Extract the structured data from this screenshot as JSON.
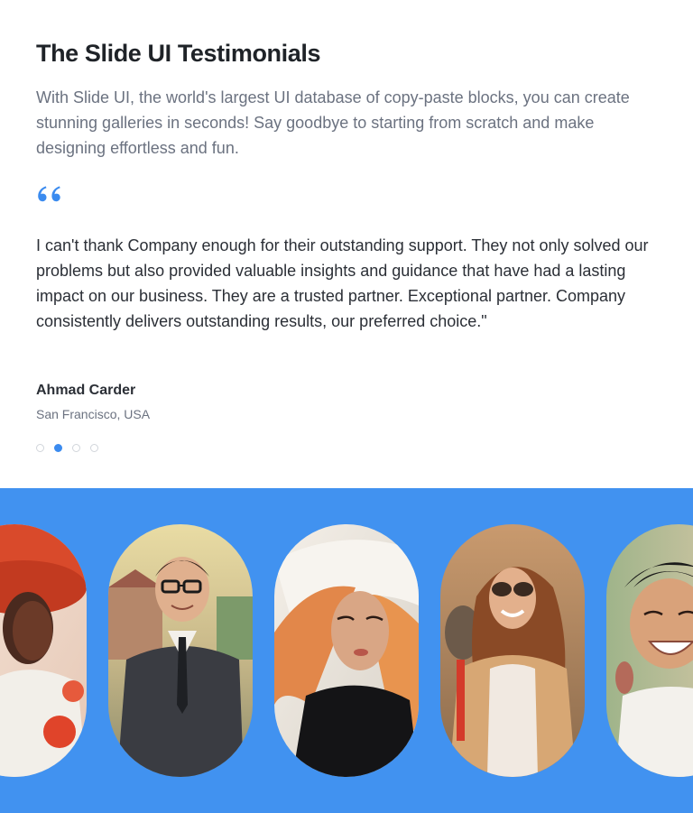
{
  "title": "The Slide UI Testimonials",
  "subtitle": "With Slide UI, the world's largest UI database of copy-paste blocks, you can create stunning galleries in seconds! Say goodbye to starting from scratch and make designing effortless and fun.",
  "quote_icon": "quote-mark-icon",
  "testimonial": {
    "text": "I can't thank Company enough for their outstanding support. They not only solved our problems but also provided valuable insights and guidance that have had a lasting impact on our business. They are a trusted partner. Exceptional partner. Company consistently delivers outstanding results, our preferred choice.\"",
    "author": "Ahmad Carder",
    "location": "San Francisco, USA"
  },
  "pagination": {
    "count": 4,
    "active_index": 1
  },
  "colors": {
    "accent": "#3b8bef",
    "band": "#4192f0",
    "title": "#1f2328",
    "muted": "#6b7280"
  },
  "gallery": [
    "portrait-woman-red-hat",
    "portrait-man-glasses-suit",
    "portrait-woman-windswept-hair",
    "portrait-woman-sunglasses",
    "portrait-man-smiling"
  ]
}
